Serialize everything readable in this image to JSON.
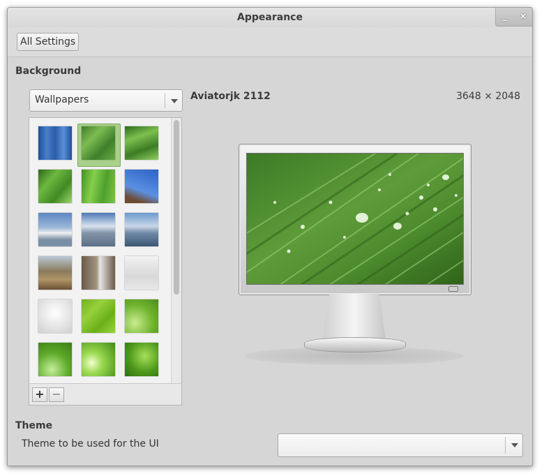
{
  "window": {
    "title": "Appearance",
    "minimize_glyph": "_",
    "close_glyph": "×"
  },
  "toolbar": {
    "all_settings_label": "All Settings"
  },
  "background": {
    "heading": "Background",
    "source_select": {
      "value": "Wallpapers"
    },
    "selected": {
      "name": "Aviatorjk 2112",
      "resolution": "3648 × 2048"
    },
    "add_glyph": "+",
    "remove_glyph": "−",
    "thumbnails": [
      {
        "name": "blue-stripes-thumb",
        "bg": "linear-gradient(90deg,#1d4f9a,#4b7fcb,#2a5ca8,#5a8fd6,#1d4f9a)"
      },
      {
        "name": "green-leaf-drops-thumb",
        "bg": "linear-gradient(135deg,#3f7f2a,#7dbb52,#3f7f2a,#6aa945)"
      },
      {
        "name": "grass-drops-thumb",
        "bg": "linear-gradient(160deg,#2f6b1c,#7cc04e,#3c7c24,#93d066)"
      },
      {
        "name": "green-blade-thumb",
        "bg": "linear-gradient(130deg,#2b6818,#6db83f,#3f8a23,#9fd66d)"
      },
      {
        "name": "green-leaf-thumb",
        "bg": "linear-gradient(100deg,#3f9221,#86cf4c,#4da12c,#7fc349)"
      },
      {
        "name": "blue-sky-tree-thumb",
        "bg": "linear-gradient(200deg,#2c63c8,#5b90e0 60%,#6d4b32 85%)"
      },
      {
        "name": "winter-lake-trees-thumb",
        "bg": "linear-gradient(#5d87c4,#9fb9d8 45%,#f0f0f0 60%,#7a8fa6 80%)"
      },
      {
        "name": "snowy-mountains-thumb",
        "bg": "linear-gradient(#4f79b8,#d8e2ee 40%,#8294a8 60%,#5c6f85)"
      },
      {
        "name": "mountain-lake-thumb",
        "bg": "linear-gradient(#6c9ad0,#c9d7e6 40%,#6f8aa8 60%,#3b5672)"
      },
      {
        "name": "canyon-thumb",
        "bg": "linear-gradient(#b9c9d8,#8a7a5a 45%,#b09467 70%,#6b5234)"
      },
      {
        "name": "waterfall-canyon-thumb",
        "bg": "linear-gradient(90deg,#6b5a48,#a09480 45%,#e5e5e5 55%,#6a5a48)"
      },
      {
        "name": "green-pencil-thumb",
        "bg": "linear-gradient(#f2f2f2,#d8d8d8 60%,#e8e8e8)"
      },
      {
        "name": "mint-logo-grey-thumb",
        "bg": "radial-gradient(circle at 50% 40%,#ffffff,#cfcfcf)"
      },
      {
        "name": "green-texture-thumb",
        "bg": "linear-gradient(135deg,#6fb31f,#96d03a,#6ab01a,#9ad43f)"
      },
      {
        "name": "green-swirl-thumb",
        "bg": "radial-gradient(circle at 30% 70%,#c9ec8f,#6fb32e 55%,#4c8e1c)"
      },
      {
        "name": "green-curves-thumb",
        "bg": "radial-gradient(circle at 40% 80%,#c5ee9b,#5eaa2a 50%,#3b7e16)"
      },
      {
        "name": "green-rays-thumb",
        "bg": "radial-gradient(circle at 30% 60%,#f2ffd0,#9ad94f 35%,#3f8a18)"
      },
      {
        "name": "green-bokeh-thumb",
        "bg": "radial-gradient(circle at 60% 40%,#a8e05a,#4f9a1c 55%,#2f6d0e)"
      }
    ]
  },
  "theme": {
    "heading": "Theme",
    "label": "Theme to be used for the UI",
    "select_value": ""
  }
}
